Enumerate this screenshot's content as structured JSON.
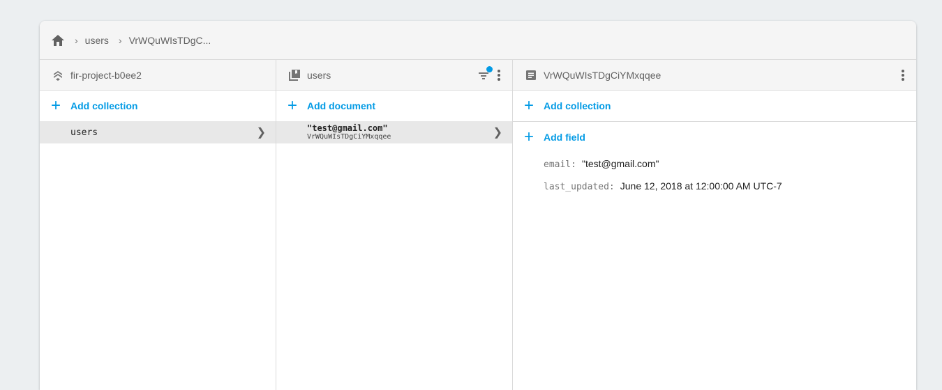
{
  "breadcrumb": {
    "home_icon": "home-icon",
    "items": [
      "users",
      "VrWQuWIsTDgC..."
    ]
  },
  "columns": {
    "root": {
      "title": "fir-project-b0ee2",
      "icon": "firestore-project-icon",
      "add_label": "Add collection",
      "items": [
        {
          "label": "users"
        }
      ]
    },
    "collection": {
      "title": "users",
      "icon": "collection-icon",
      "add_label": "Add document",
      "items": [
        {
          "label": "\"test@gmail.com\"",
          "sublabel": "VrWQuWIsTDgCiYMxqqee"
        }
      ]
    },
    "document": {
      "title": "VrWQuWIsTDgCiYMxqqee",
      "icon": "document-icon",
      "add_collection_label": "Add collection",
      "add_field_label": "Add field",
      "fields": [
        {
          "key": "email:",
          "value": "\"test@gmail.com\""
        },
        {
          "key": "last_updated:",
          "value": "June 12, 2018 at 12:00:00 AM UTC-7"
        }
      ]
    }
  },
  "colors": {
    "accent": "#039be5",
    "header_bg": "#f5f5f5",
    "selected_bg": "#e8e8e8"
  }
}
